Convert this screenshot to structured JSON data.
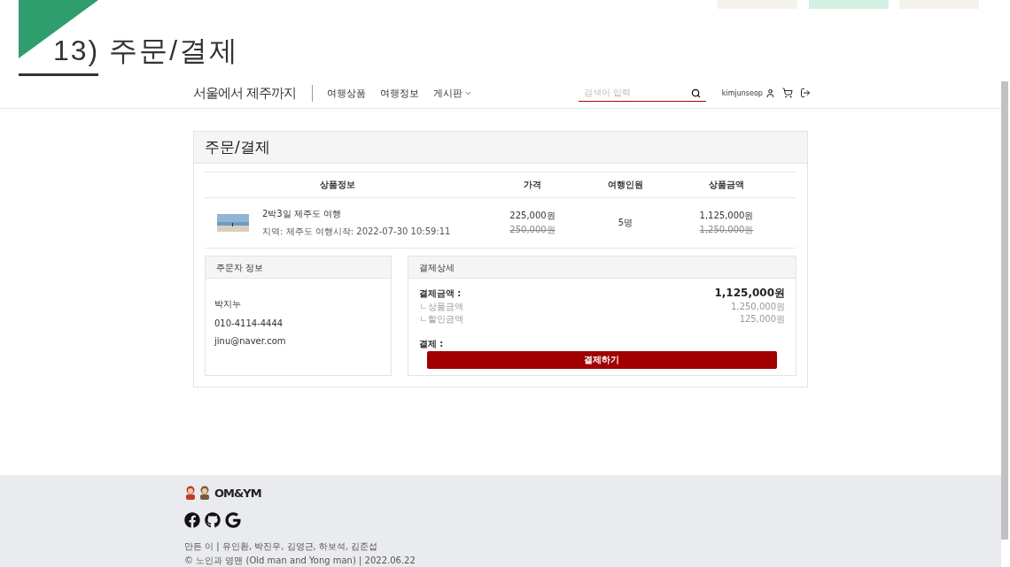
{
  "slide": {
    "title": "13) 주문/결제"
  },
  "site": {
    "logo": "서울에서 제주까지",
    "nav": [
      {
        "label": "여행상품",
        "dropdown": false
      },
      {
        "label": "여행정보",
        "dropdown": false
      },
      {
        "label": "게시판",
        "dropdown": true
      }
    ],
    "search": {
      "placeholder": "검색어 입력"
    },
    "user": "kimjunseop"
  },
  "order": {
    "title": "주문/결제",
    "columns": [
      "상품정보",
      "가격",
      "여행인원",
      "상품금액"
    ],
    "item": {
      "name": "2박3일 제주도 여행",
      "meta": "지역: 제주도 여행시작: 2022-07-30 10:59:11",
      "price": "225,000원",
      "old_price": "250,000원",
      "people": "5명",
      "amount": "1,125,000원",
      "old_amount": "1,250,000원"
    },
    "buyer": {
      "title": "주문자 정보",
      "name": "박지누",
      "phone": "010-4114-4444",
      "email": "jinu@naver.com"
    },
    "payment": {
      "title": "결제상세",
      "total_label": "결제금액 :",
      "total": "1,125,000원",
      "rows": [
        {
          "label": "ㄴ상품금액",
          "value": "1,250,000원"
        },
        {
          "label": "ㄴ할인금액",
          "value": "125,000원"
        }
      ],
      "method_label": "결제 :",
      "button": "결제하기"
    }
  },
  "footer": {
    "brand": "OM&YM",
    "makers": "만든 이 | 유인환, 박진우, 김영근, 하보석, 김준섭",
    "copyright": "© 노인과 영맨 (Old man and Yong man) | 2022.06.22"
  }
}
